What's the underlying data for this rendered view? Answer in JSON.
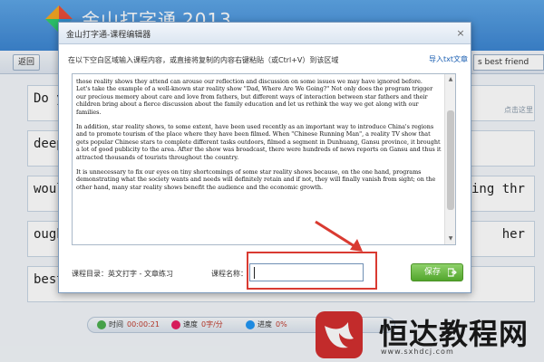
{
  "app": {
    "title": "金山打字通",
    "year": "2013",
    "back_label": "返回",
    "course_search_value": "s best friend"
  },
  "practice": {
    "lines": [
      {
        "text": "Do y",
        "tail": ""
      },
      {
        "text": "deep",
        "tail": ""
      },
      {
        "text": "woul",
        "tail": "ing thr"
      },
      {
        "text": "ough",
        "tail": "her"
      },
      {
        "text": "best",
        "tail": ""
      }
    ],
    "hint": "点击这里"
  },
  "status": {
    "time_label": "时间",
    "time_value": "00:00:21",
    "speed_label": "速度",
    "speed_value": "0字/分",
    "progress_label": "进度",
    "progress_value": "0%"
  },
  "watermark": {
    "text": "恒达教程网",
    "url": "www.sxhdcj.com"
  },
  "modal": {
    "title": "金山打字通-课程编辑器",
    "close": "×",
    "instruction": "在以下空白区域输入课程内容，或直接将复制的内容右键粘贴（或Ctrl+V）到该区域",
    "import_label": "导入txt文章",
    "paragraphs": [
      "those reality shows they attend can arouse our reflection and discussion on some issues we may have ignored before.",
      "Let's take the example of a well-known star reality show \"Dad, Where Are We Going?\" Not only does the program trigger our precious memory about care and love from fathers, but different ways of interaction between star fathers and their children bring about a fierce discussion about the family education and let us rethink the way we get along with our families.",
      "In addition, star reality shows, to some extent, have been used recently as an important way to introduce China's regions and to promote tourism of the place where they have been filmed. When \"Chinese Running Man\", a reality TV show that gets popular Chinese stars to complete different tasks outdoors, filmed a segment in Dunhuang, Gansu province, it brought a lot of good publicity to the area. After the show was broadcast, there were hundreds of news reports on Gansu and thus it attracted thousands of tourists throughout the country.",
      "It is unnecessary to fix our eyes on tiny shortcomings of some star reality shows because, on the one hand, programs demonstrating what the society wants and needs will definitely retain and if not, they will finally vanish from sight; on the other hand, many star reality shows benefit the audience and the economic growth."
    ],
    "catalog_label": "课程目录：英文打字 - 文章练习",
    "name_label": "课程名称：",
    "name_value": "",
    "save_label": "保存"
  },
  "colors": {
    "highlight": "#d93a31",
    "save_green": "#52a52c",
    "title_blue": "#3d86d2"
  }
}
